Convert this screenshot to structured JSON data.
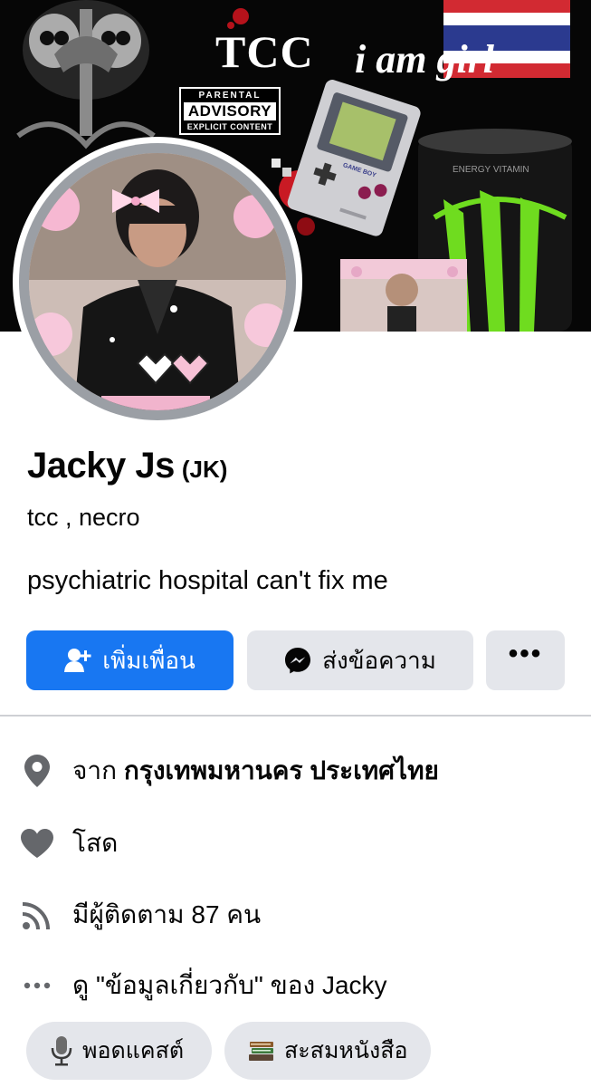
{
  "cover": {
    "text_tcc": "TCC",
    "text_girl": "i am girl",
    "advisory": {
      "top": "PARENTAL",
      "main": "ADVISORY",
      "bottom": "EXPLICIT CONTENT"
    },
    "gameboy_label": "GAME BOY",
    "flag_colors": [
      "#d22a32",
      "#ffffff",
      "#2b3a8f",
      "#ffffff",
      "#d22a32"
    ]
  },
  "profile": {
    "name": "Jacky Js",
    "alternate_name": "(JK)",
    "subtitle": "tcc , necro",
    "bio": "psychiatric hospital can't fix me"
  },
  "actions": {
    "add_friend": "เพิ่มเพื่อน",
    "message": "ส่งข้อความ",
    "more": "•••"
  },
  "intro": {
    "from_prefix": "จาก",
    "from_place": "กรุงเทพมหานคร ประเทศไทย",
    "relationship": "โสด",
    "followers": "มีผู้ติดตาม 87 คน",
    "about": "ดู \"ข้อมูลเกี่ยวกับ\" ของ Jacky"
  },
  "chips": [
    {
      "label": "พอดแคสต์",
      "icon": "microphone-icon"
    },
    {
      "label": "สะสมหนังสือ",
      "icon": "books-icon"
    }
  ],
  "colors": {
    "primary": "#1877f2",
    "secondary_button": "#e4e6eb",
    "icon_gray": "#65676b",
    "divider": "#ced0d4"
  }
}
